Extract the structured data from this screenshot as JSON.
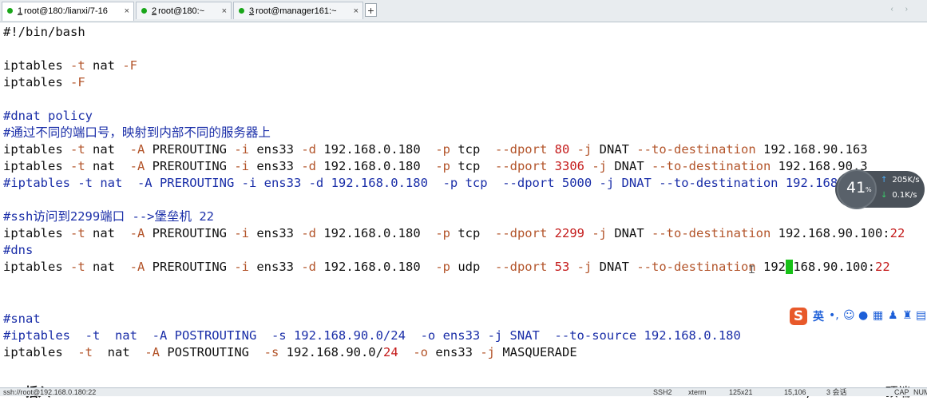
{
  "tabs": [
    {
      "num": "1",
      "label": "root@180:/lianxi/7-16",
      "active": true
    },
    {
      "num": "2",
      "label": "root@180:~",
      "active": false
    },
    {
      "num": "3",
      "label": "root@manager161:~",
      "active": false
    }
  ],
  "tab_close": "×",
  "tab_add": "+",
  "tab_nav": "‹ ›",
  "editor": {
    "lines": [
      "#!/bin/bash",
      "",
      "iptables -t nat -F",
      "iptables -F",
      "",
      "#dnat policy",
      "#通过不同的端口号，映射到内部不同的服务器上",
      "iptables -t nat  -A PREROUTING -i ens33 -d 192.168.0.180  -p tcp  --dport 80 -j DNAT --to-destination 192.168.90.163",
      "iptables -t nat  -A PREROUTING -i ens33 -d 192.168.0.180  -p tcp  --dport 3306 -j DNAT --to-destination 192.168.90.3",
      "#iptables -t nat  -A PREROUTING -i ens33 -d 192.168.0.180  -p tcp  --dport 5000 -j DNAT --to-destination 192.168.90.163",
      "",
      "#ssh访问到2299端口 -->堡垒机 22",
      "iptables -t nat  -A PREROUTING -i ens33 -d 192.168.0.180  -p tcp  --dport 2299 -j DNAT --to-destination 192.168.90.100:22",
      "#dns",
      "iptables -t nat  -A PREROUTING -i ens33 -d 192.168.0.180  -p udp  --dport 53 -j DNAT --to-destination 192.168.90.100:22",
      "",
      "",
      "#snat",
      "#iptables  -t  nat  -A POSTROUTING  -s 192.168.90.0/24  -o ens33 -j SNAT  --to-source 192.168.0.180",
      "iptables  -t  nat  -A POSTROUTING  -s 192.168.90.0/24  -o ens33 -j MASQUERADE"
    ],
    "mode": "-- 插入 --",
    "cursor_position": "15,106",
    "scroll_position": "顶端"
  },
  "network_widget": {
    "percent": "41",
    "unit": "%",
    "upload": "205K/s",
    "download": "0.1K/s"
  },
  "ime": {
    "logo": "S",
    "lang": "英"
  },
  "statusbar": {
    "connection": "ssh://root@192.168.0.180:22",
    "protocol": "SSH2",
    "terminal": "xterm",
    "size": "125x21",
    "position": "15,106",
    "sessions": "3 会话",
    "caps": "CAP",
    "num": "NUM"
  },
  "colors": {
    "comment": "#1a2ea8",
    "option": "#b3542a",
    "number": "#c41a1a",
    "cursor": "#17c117"
  }
}
